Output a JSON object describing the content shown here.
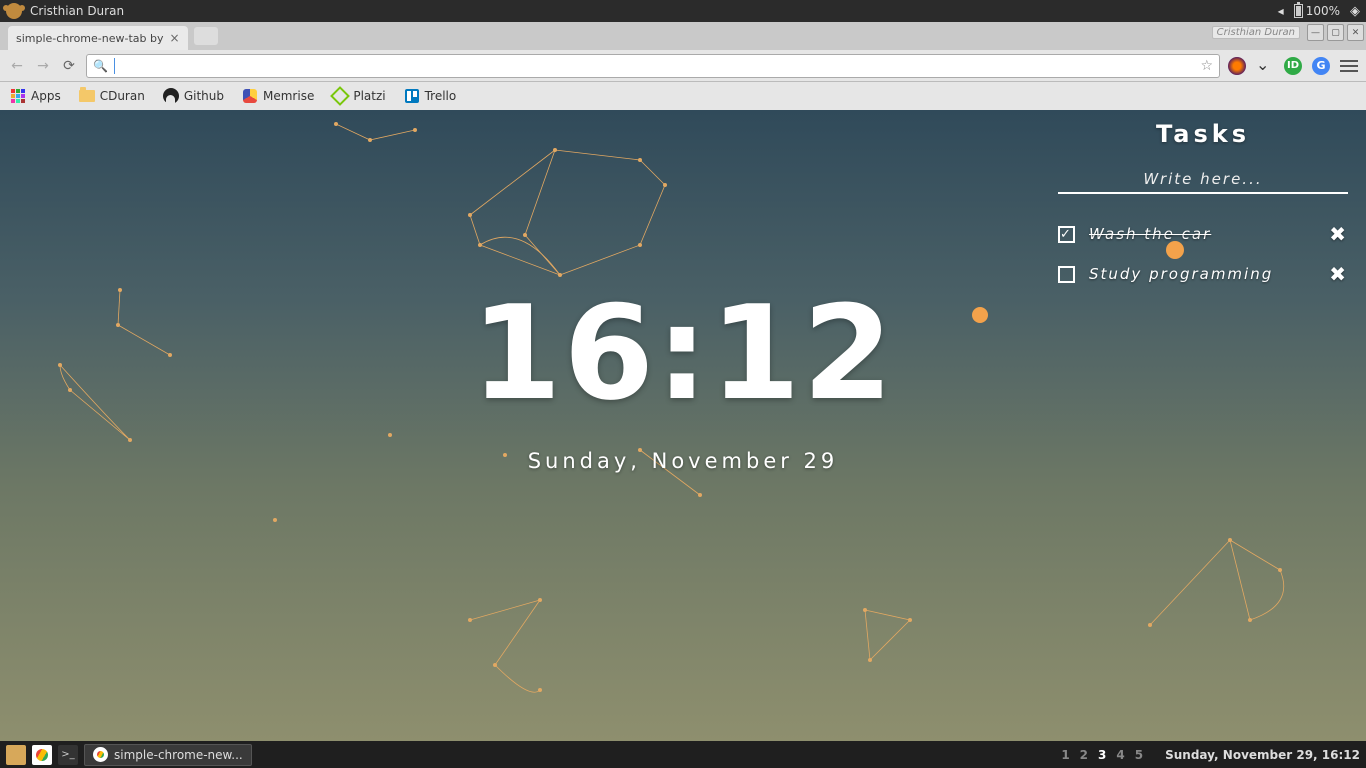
{
  "os_top": {
    "user": "Cristhian Duran",
    "battery": "100%"
  },
  "browser": {
    "tab_title": "simple-chrome-new-tab by",
    "window_user": "Cristhian Duran",
    "bookmarks": [
      {
        "id": "apps",
        "label": "Apps"
      },
      {
        "id": "cduran",
        "label": "CDuran"
      },
      {
        "id": "github",
        "label": "Github"
      },
      {
        "id": "memrise",
        "label": "Memrise"
      },
      {
        "id": "platzi",
        "label": "Platzi"
      },
      {
        "id": "trello",
        "label": "Trello"
      }
    ],
    "ext_idp_label": "ID",
    "ext_translate_label": "G"
  },
  "clock": {
    "time": "16:12",
    "date": "Sunday, November 29"
  },
  "tasks": {
    "title": "Tasks",
    "placeholder": "Write here...",
    "items": [
      {
        "label": "Wash the car",
        "done": true
      },
      {
        "label": "Study programming",
        "done": false
      }
    ]
  },
  "taskbar": {
    "active_window": "simple-chrome-new...",
    "workspaces": [
      "1",
      "2",
      "3",
      "4",
      "5"
    ],
    "active_ws": "3",
    "datetime": "Sunday, November 29, 16:12"
  },
  "check_glyph": "✓"
}
